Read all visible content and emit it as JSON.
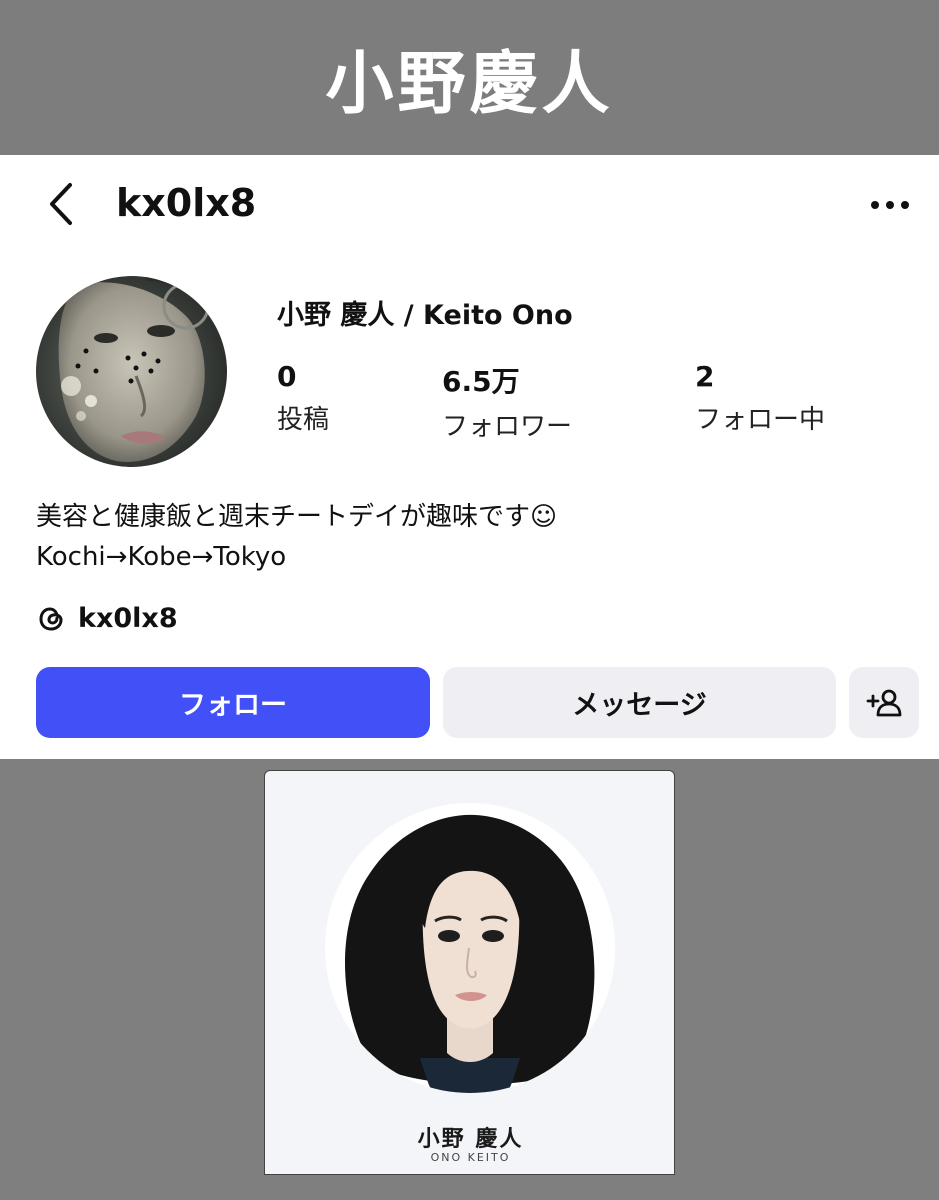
{
  "banner": {
    "title": "小野慶人"
  },
  "header": {
    "username": "kx0lx8"
  },
  "profile": {
    "display_name": "小野 慶人 / Keito Ono",
    "stats": [
      {
        "value": "0",
        "label": "投稿"
      },
      {
        "value": "6.5万",
        "label": "フォロワー"
      },
      {
        "value": "2",
        "label": "フォロー中"
      }
    ],
    "bio_lines": [
      "美容と健康飯と週末チートデイが趣味です☺",
      "Kochi→Kobe→Tokyo"
    ],
    "threads_handle": "kx0lx8"
  },
  "actions": {
    "follow_label": "フォロー",
    "message_label": "メッセージ"
  },
  "card": {
    "name": "小野 慶人",
    "romaji": "ONO KEITO"
  },
  "colors": {
    "follow_button": "#4150f7",
    "secondary_button": "#efeff3",
    "background": "#7f7f7f"
  },
  "icons": [
    "back-chevron-icon",
    "more-dots-icon",
    "threads-icon",
    "add-person-icon"
  ]
}
